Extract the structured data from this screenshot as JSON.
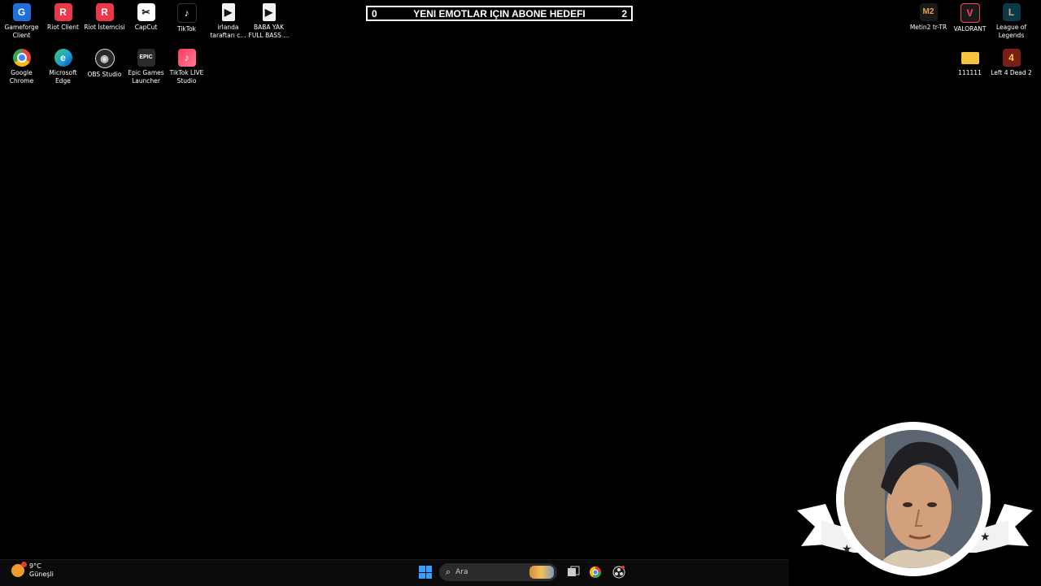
{
  "desktop_icons_left": [
    {
      "label": "Gameforge\nClient",
      "icon": "gameforge-icon",
      "color": "#1e6fd9",
      "glyph": "G"
    },
    {
      "label": "Riot Client",
      "icon": "riot-client-icon",
      "color": "#e8384a",
      "glyph": "R"
    },
    {
      "label": "Riot İstemcisi",
      "icon": "riot-istemcisi-icon",
      "color": "#e8384a",
      "glyph": "R"
    },
    {
      "label": "CapCut",
      "icon": "capcut-icon",
      "color": "#ffffff",
      "glyph": "✂"
    },
    {
      "label": "TikTok",
      "icon": "tiktok-icon",
      "color": "#000000",
      "glyph": "♪"
    },
    {
      "label": "irlanda\ntaraftarı c...",
      "icon": "video-file-icon",
      "color": "#f2f2f2",
      "glyph": "▶"
    },
    {
      "label": "BABA YAK\nFULL BASS ...",
      "icon": "video-file-icon",
      "color": "#f2f2f2",
      "glyph": "▶"
    },
    {
      "label": "Google\nChrome",
      "icon": "chrome-icon",
      "color": "#34a853",
      "glyph": "●"
    },
    {
      "label": "Microsoft\nEdge",
      "icon": "edge-icon",
      "color": "#1c9ad6",
      "glyph": "e"
    },
    {
      "label": "OBS Studio",
      "icon": "obs-icon",
      "color": "#3a3a3a",
      "glyph": "◉"
    },
    {
      "label": "Epic Games\nLauncher",
      "icon": "epic-games-icon",
      "color": "#2a2a2a",
      "glyph": "EPIC"
    },
    {
      "label": "TikTok LIVE\nStudio",
      "icon": "tiktok-live-icon",
      "color": "#ff3b5c",
      "glyph": "♪"
    }
  ],
  "desktop_icons_right": [
    {
      "label": "Metin2 tr-TR",
      "icon": "metin2-icon",
      "color": "#c98a2b",
      "glyph": "M2"
    },
    {
      "label": "VALORANT",
      "icon": "valorant-icon",
      "color": "#fd4556",
      "glyph": "V"
    },
    {
      "label": "League of\nLegends",
      "icon": "league-icon",
      "color": "#c8aa6e",
      "glyph": "L"
    },
    {
      "label": "111111",
      "icon": "folder-icon",
      "color": "#f5c542",
      "glyph": ""
    },
    {
      "label": "Left 4 Dead 2",
      "icon": "left4dead-icon",
      "color": "#c0392b",
      "glyph": "4"
    }
  ],
  "goal": {
    "left": "0",
    "title": "YENI EMOTLAR IÇIN ABONE HEDEFI",
    "right": "2"
  },
  "weather": {
    "temp": "9°C",
    "condition": "Güneşli"
  },
  "search": {
    "placeholder": "Ara"
  }
}
